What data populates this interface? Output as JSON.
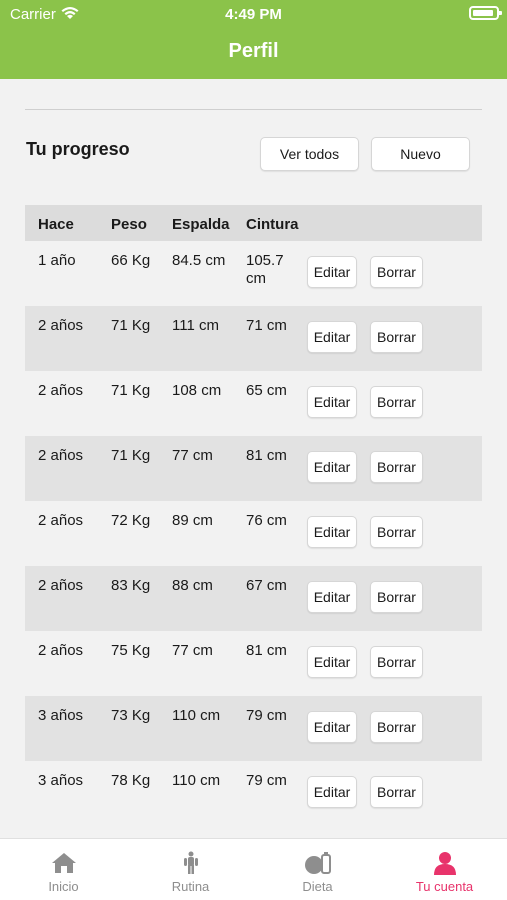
{
  "status_bar": {
    "carrier": "Carrier",
    "time": "4:49 PM"
  },
  "header": {
    "title": "Perfil"
  },
  "progress": {
    "title": "Tu progreso",
    "view_all_label": "Ver todos",
    "new_label": "Nuevo",
    "columns": [
      "Hace",
      "Peso",
      "Espalda",
      "Cintura"
    ],
    "edit_label": "Editar",
    "delete_label": "Borrar",
    "rows": [
      {
        "hace": "1 año",
        "peso": "66 Kg",
        "espalda": "84.5 cm",
        "cintura": "105.7 cm"
      },
      {
        "hace": "2 años",
        "peso": "71 Kg",
        "espalda": "111 cm",
        "cintura": "71 cm"
      },
      {
        "hace": "2 años",
        "peso": "71 Kg",
        "espalda": "108 cm",
        "cintura": "65 cm"
      },
      {
        "hace": "2 años",
        "peso": "71 Kg",
        "espalda": "77 cm",
        "cintura": "81 cm"
      },
      {
        "hace": "2 años",
        "peso": "72 Kg",
        "espalda": "89 cm",
        "cintura": "76 cm"
      },
      {
        "hace": "2 años",
        "peso": "83 Kg",
        "espalda": "88 cm",
        "cintura": "67 cm"
      },
      {
        "hace": "2 años",
        "peso": "75 Kg",
        "espalda": "77 cm",
        "cintura": "81 cm"
      },
      {
        "hace": "3 años",
        "peso": "73 Kg",
        "espalda": "110 cm",
        "cintura": "79 cm"
      },
      {
        "hace": "3 años",
        "peso": "78 Kg",
        "espalda": "110 cm",
        "cintura": "79 cm"
      }
    ]
  },
  "tabbar": {
    "items": [
      {
        "label": "Inicio",
        "icon": "home-icon"
      },
      {
        "label": "Rutina",
        "icon": "figure-icon"
      },
      {
        "label": "Dieta",
        "icon": "food-icon"
      },
      {
        "label": "Tu cuenta",
        "icon": "user-icon",
        "active": true
      }
    ]
  },
  "colors": {
    "header": "#8bc34a",
    "active_tab": "#e8336b"
  }
}
